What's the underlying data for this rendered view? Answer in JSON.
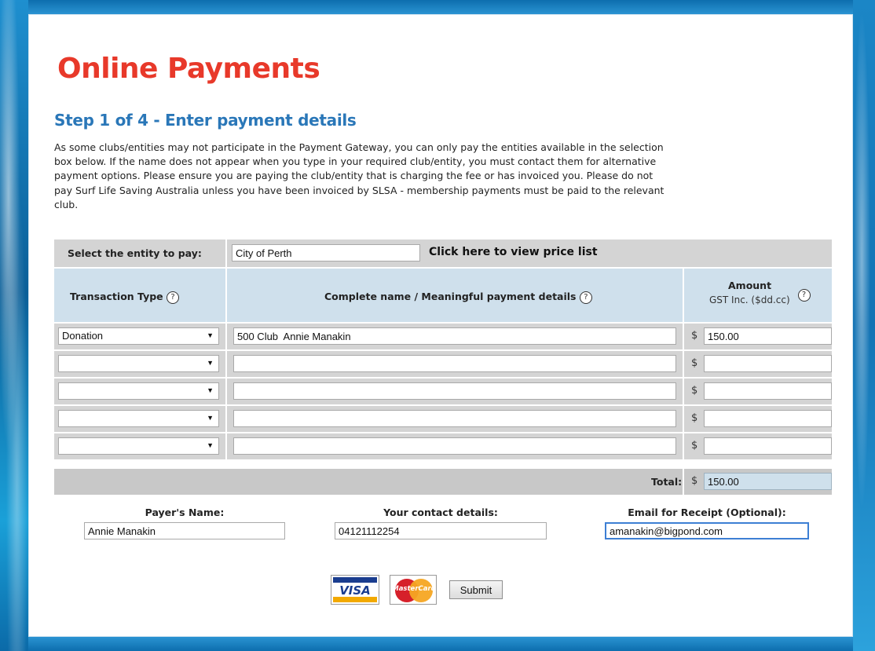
{
  "page": {
    "title": "Online Payments",
    "step_title": "Step 1 of 4 - Enter payment details",
    "intro": "As some clubs/entities may not participate in the Payment Gateway, you can only pay the entities available in the selection box below. If the name does not appear when you type in your required club/entity, you must contact them for alternative payment options. Please ensure you are paying the club/entity that is charging the fee or has invoiced you. Please do not pay Surf Life Saving Australia unless you have been invoiced by SLSA - membership payments must be paid to the relevant club."
  },
  "entity": {
    "label": "Select the entity to pay:",
    "value": "City of Perth",
    "price_list_link": "Click here to view price list"
  },
  "table": {
    "headers": {
      "transaction_type": "Transaction Type",
      "details": "Complete name / Meaningful payment details",
      "amount": "Amount",
      "amount_sub": "GST Inc. ($dd.cc)"
    },
    "help_glyph": "?",
    "currency": "$",
    "rows": [
      {
        "type": "Donation",
        "details": "500 Club  Annie Manakin",
        "amount": "150.00"
      },
      {
        "type": "",
        "details": "",
        "amount": ""
      },
      {
        "type": "",
        "details": "",
        "amount": ""
      },
      {
        "type": "",
        "details": "",
        "amount": ""
      },
      {
        "type": "",
        "details": "",
        "amount": ""
      }
    ],
    "total_label": "Total:",
    "total_value": "150.00"
  },
  "payer": {
    "name_label": "Payer's Name:",
    "name_value": "Annie Manakin",
    "contact_label": "Your contact details:",
    "contact_value": "04121112254",
    "email_label": "Email for Receipt (Optional):",
    "email_value": "amanakin@bigpond.com"
  },
  "actions": {
    "visa_label": "VISA",
    "mastercard_label": "MasterCard",
    "submit_label": "Submit"
  },
  "colors": {
    "title": "#e8392a",
    "step": "#2a77b8",
    "header_bg": "#cfe0ec",
    "row_bg": "#d4d4d4"
  }
}
